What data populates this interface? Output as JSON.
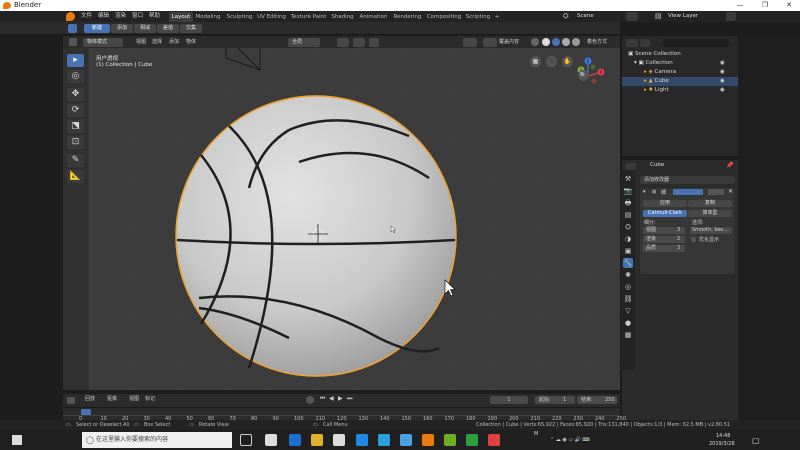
{
  "window": {
    "title": "Blender",
    "controls": [
      "—",
      "❐",
      "✕"
    ]
  },
  "menubar": {
    "menus": [
      "文件",
      "编辑",
      "渲染",
      "窗口",
      "帮助"
    ],
    "workspaces": [
      "Layout",
      "Modeling",
      "Sculpting",
      "UV Editing",
      "Texture Paint",
      "Shading",
      "Animation",
      "Rendering",
      "Compositing",
      "Scripting"
    ],
    "add_workspace": "+",
    "scene": "Scene",
    "view_layer": "View Layer"
  },
  "toolheader": {
    "buttons": [
      "新建",
      "添加",
      "相减",
      "差值",
      "交集"
    ]
  },
  "viewport_header": {
    "mode": "物体模式",
    "menus": [
      "视图",
      "选择",
      "添加",
      "物体"
    ],
    "orientation": "全局",
    "overlay_label": "覆盖内容",
    "shading_label": "着色方式"
  },
  "viewport": {
    "perspective_label": "用户透视",
    "collection_label": "(1) Collection | Cube",
    "gizmo_axes": [
      "X",
      "Y",
      "Z"
    ]
  },
  "outliner": {
    "root": "Scene Collection",
    "collection": "Collection",
    "items": [
      "Camera",
      "Cube",
      "Light"
    ]
  },
  "properties": {
    "object_name": "Cube",
    "add_modifier": "添加修改器",
    "modifier_name": "细",
    "apply": "应用",
    "copy": "复制",
    "catmull": "Catmull-Clark",
    "simple": "简单型",
    "subdiv_label": "细分:",
    "options_label": "选项:",
    "viewport_label": "视图",
    "viewport_val": "3",
    "render_label": "渲染",
    "render_val": "2",
    "quality_label": "品质",
    "quality_val": "3",
    "smooth": "Smooth, kee...",
    "optimal": "优化显示"
  },
  "timeline": {
    "menus": [
      "回放",
      "抠像",
      "视图",
      "标记"
    ],
    "current_frame": "1",
    "start_label": "起始:",
    "start": "1",
    "end_label": "结束:",
    "end": "250",
    "ticks": [
      "0",
      "10",
      "20",
      "30",
      "40",
      "50",
      "60",
      "70",
      "80",
      "90",
      "100",
      "110",
      "120",
      "130",
      "140",
      "150",
      "160",
      "170",
      "180",
      "190",
      "200",
      "210",
      "220",
      "230",
      "240",
      "250"
    ]
  },
  "status": {
    "select": "Select or Deselect All",
    "box": "Box Select",
    "rotate": "Rotate View",
    "call": "Call Menu",
    "stats": "Collection | Cube | Verts:65,922 | Faces:65,920 | Tris:131,840 | Objects:1/3 | Mem: 62.5 MB | v2.80.51"
  },
  "taskbar": {
    "search_placeholder": "在这里输入你要搜索的内容",
    "time": "14:48",
    "date": "2019/3/28",
    "lang": "M"
  },
  "colors": {
    "accent": "#4772b3",
    "selection": "#f0a030",
    "ball": "#c8c8c8"
  }
}
